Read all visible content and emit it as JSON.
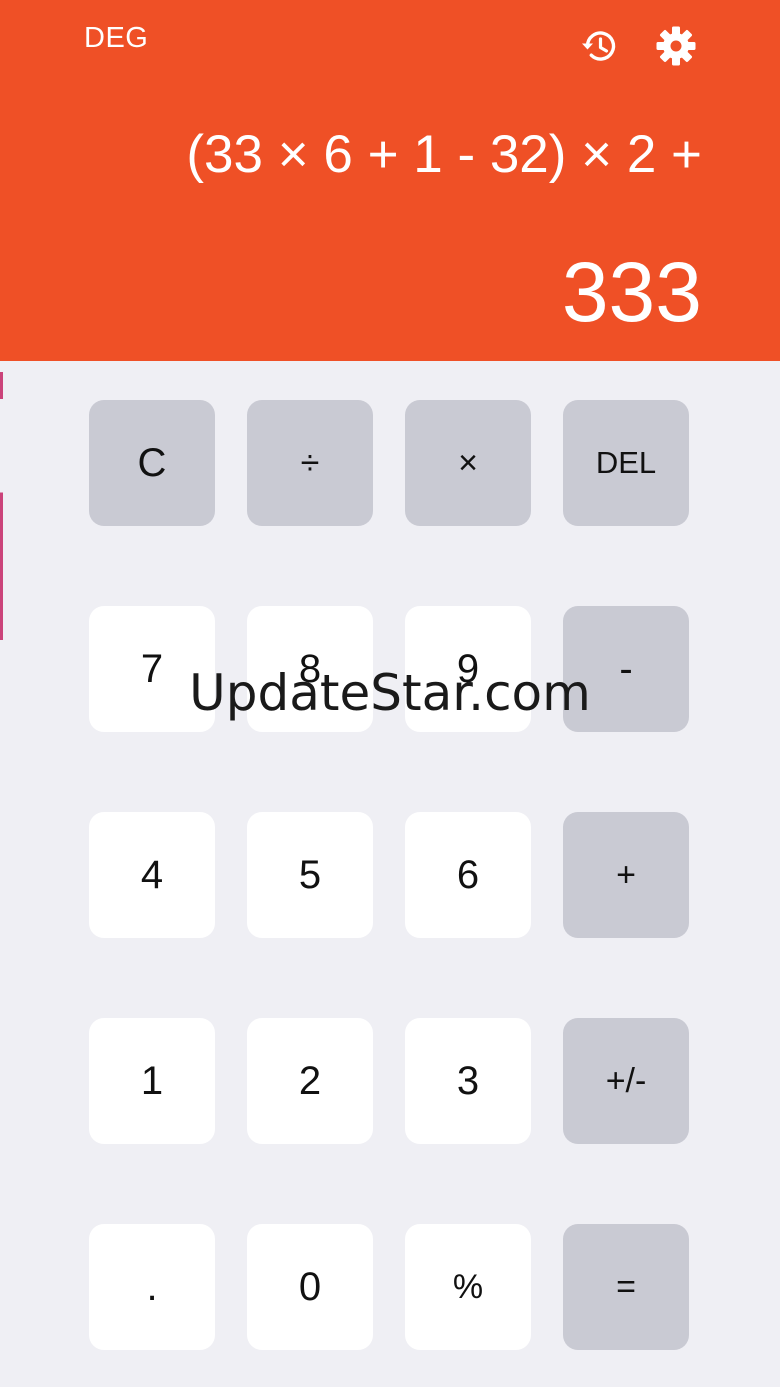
{
  "header": {
    "mode_label": "DEG",
    "expression": "(33 × 6 + 1 - 32) × 2 +",
    "result": "333",
    "icons": [
      "history-icon",
      "settings-icon"
    ],
    "background_color": "#ef5026"
  },
  "keypad": {
    "rows": [
      [
        "C",
        "÷",
        "×",
        "DEL"
      ],
      [
        "7",
        "8",
        "9",
        "-"
      ],
      [
        "4",
        "5",
        "6",
        "+"
      ],
      [
        "1",
        "2",
        "3",
        "+/-"
      ],
      [
        ".",
        "0",
        "%",
        "="
      ]
    ],
    "number_key_color": "#ffffff",
    "operator_key_color": "#c9cad3"
  },
  "watermark": "UpdateStar.com"
}
